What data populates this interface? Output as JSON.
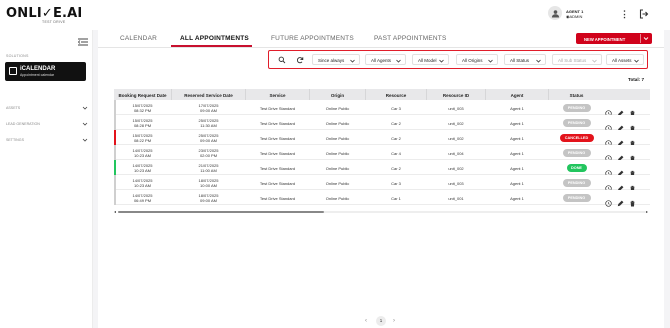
{
  "app": {
    "logo": "ONLI✓E.AI",
    "logo_sub": "TEST DRIVE"
  },
  "user": {
    "name": "AGENT 1",
    "role": "◉ADMIN",
    "menu_glyph": "⋮"
  },
  "sidebar": {
    "solutions_label": "SOLUTIONS",
    "card_title": "iCALENDAR",
    "card_subtitle": "Appointment calendar",
    "items": [
      {
        "label": "ASSETS"
      },
      {
        "label": "LEAD GENERATION"
      },
      {
        "label": "SETTINGS"
      }
    ]
  },
  "tabs": [
    {
      "label": "CALENDAR",
      "active": false
    },
    {
      "label": "ALL APPOINTMENTS",
      "active": true
    },
    {
      "label": "FUTURE APPOINTMENTS",
      "active": false
    },
    {
      "label": "PAST APPOINTMENTS",
      "active": false
    }
  ],
  "new_button": {
    "label": "NEW APPOINTMENT"
  },
  "filters": {
    "since": "Since always",
    "agents": "All Agents",
    "model": "All Model",
    "origins": "All Origins",
    "status": "All Status",
    "sub_status": "All Sub Status",
    "assets": "All Assets"
  },
  "total_label": "Total: 7",
  "table": {
    "headers": [
      "Booking Request Date",
      "Reserved Service Date",
      "Service",
      "Origin",
      "Resource",
      "Resource ID",
      "Agent",
      "Status"
    ],
    "rows": [
      {
        "booking_date": "15/07/2025",
        "booking_time": "08:32 PM",
        "service_date": "17/07/2025",
        "service_time": "09:00 AM",
        "service": "Test Drive Standard",
        "origin": "Online Public",
        "resource": "Car 3",
        "resource_id": "unit_003",
        "agent": "Agent 1",
        "status": "PENDING",
        "accent": "#cfcfcf"
      },
      {
        "booking_date": "15/07/2025",
        "booking_time": "08:28 PM",
        "service_date": "25/07/2025",
        "service_time": "11:30 AM",
        "service": "Test Drive Standard",
        "origin": "Online Public",
        "resource": "Car 2",
        "resource_id": "unit_002",
        "agent": "Agent 1",
        "status": "PENDING",
        "accent": "#cfcfcf"
      },
      {
        "booking_date": "15/07/2025",
        "booking_time": "08:22 PM",
        "service_date": "25/07/2025",
        "service_time": "09:00 AM",
        "service": "Test Drive Standard",
        "origin": "Online Public",
        "resource": "Car 2",
        "resource_id": "unit_002",
        "agent": "Agent 1",
        "status": "CANCELLED",
        "accent": "#e3131b"
      },
      {
        "booking_date": "14/07/2025",
        "booking_time": "10:23 AM",
        "service_date": "23/07/2025",
        "service_time": "02:00 PM",
        "service": "Test Drive Standard",
        "origin": "Online Public",
        "resource": "Car 4",
        "resource_id": "unit_004",
        "agent": "Agent 1",
        "status": "PENDING",
        "accent": "#cfcfcf"
      },
      {
        "booking_date": "14/07/2025",
        "booking_time": "10:23 AM",
        "service_date": "21/07/2025",
        "service_time": "11:00 AM",
        "service": "Test Drive Standard",
        "origin": "Online Public",
        "resource": "Car 2",
        "resource_id": "unit_002",
        "agent": "Agent 1",
        "status": "DONE",
        "accent": "#22c55e"
      },
      {
        "booking_date": "14/07/2025",
        "booking_time": "10:23 AM",
        "service_date": "18/07/2025",
        "service_time": "10:00 AM",
        "service": "Test Drive Standard",
        "origin": "Online Public",
        "resource": "Car 3",
        "resource_id": "unit_003",
        "agent": "Agent 1",
        "status": "PENDING",
        "accent": "#cfcfcf"
      },
      {
        "booking_date": "14/07/2025",
        "booking_time": "06:49 PM",
        "service_date": "18/07/2025",
        "service_time": "09:00 AM",
        "service": "Test Drive Standard",
        "origin": "Online Public",
        "resource": "Car 1",
        "resource_id": "unit_001",
        "agent": "Agent 1",
        "status": "PENDING",
        "accent": "#cfcfcf"
      }
    ]
  },
  "status_colors": {
    "PENDING": "#c4c4c4",
    "CANCELLED": "#e3131b",
    "DONE": "#22c55e"
  },
  "pagination": {
    "current": "1",
    "prev": "‹",
    "next": "›"
  }
}
